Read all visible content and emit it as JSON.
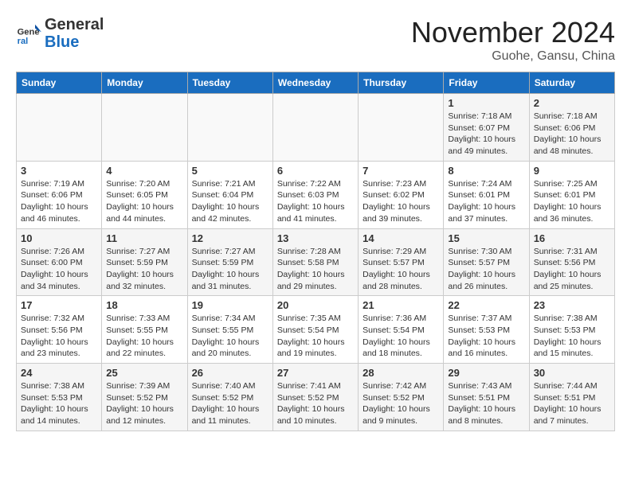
{
  "header": {
    "logo_line1": "General",
    "logo_line2": "Blue",
    "month": "November 2024",
    "location": "Guohe, Gansu, China"
  },
  "weekdays": [
    "Sunday",
    "Monday",
    "Tuesday",
    "Wednesday",
    "Thursday",
    "Friday",
    "Saturday"
  ],
  "weeks": [
    [
      {
        "day": "",
        "detail": ""
      },
      {
        "day": "",
        "detail": ""
      },
      {
        "day": "",
        "detail": ""
      },
      {
        "day": "",
        "detail": ""
      },
      {
        "day": "",
        "detail": ""
      },
      {
        "day": "1",
        "detail": "Sunrise: 7:18 AM\nSunset: 6:07 PM\nDaylight: 10 hours\nand 49 minutes."
      },
      {
        "day": "2",
        "detail": "Sunrise: 7:18 AM\nSunset: 6:06 PM\nDaylight: 10 hours\nand 48 minutes."
      }
    ],
    [
      {
        "day": "3",
        "detail": "Sunrise: 7:19 AM\nSunset: 6:06 PM\nDaylight: 10 hours\nand 46 minutes."
      },
      {
        "day": "4",
        "detail": "Sunrise: 7:20 AM\nSunset: 6:05 PM\nDaylight: 10 hours\nand 44 minutes."
      },
      {
        "day": "5",
        "detail": "Sunrise: 7:21 AM\nSunset: 6:04 PM\nDaylight: 10 hours\nand 42 minutes."
      },
      {
        "day": "6",
        "detail": "Sunrise: 7:22 AM\nSunset: 6:03 PM\nDaylight: 10 hours\nand 41 minutes."
      },
      {
        "day": "7",
        "detail": "Sunrise: 7:23 AM\nSunset: 6:02 PM\nDaylight: 10 hours\nand 39 minutes."
      },
      {
        "day": "8",
        "detail": "Sunrise: 7:24 AM\nSunset: 6:01 PM\nDaylight: 10 hours\nand 37 minutes."
      },
      {
        "day": "9",
        "detail": "Sunrise: 7:25 AM\nSunset: 6:01 PM\nDaylight: 10 hours\nand 36 minutes."
      }
    ],
    [
      {
        "day": "10",
        "detail": "Sunrise: 7:26 AM\nSunset: 6:00 PM\nDaylight: 10 hours\nand 34 minutes."
      },
      {
        "day": "11",
        "detail": "Sunrise: 7:27 AM\nSunset: 5:59 PM\nDaylight: 10 hours\nand 32 minutes."
      },
      {
        "day": "12",
        "detail": "Sunrise: 7:27 AM\nSunset: 5:59 PM\nDaylight: 10 hours\nand 31 minutes."
      },
      {
        "day": "13",
        "detail": "Sunrise: 7:28 AM\nSunset: 5:58 PM\nDaylight: 10 hours\nand 29 minutes."
      },
      {
        "day": "14",
        "detail": "Sunrise: 7:29 AM\nSunset: 5:57 PM\nDaylight: 10 hours\nand 28 minutes."
      },
      {
        "day": "15",
        "detail": "Sunrise: 7:30 AM\nSunset: 5:57 PM\nDaylight: 10 hours\nand 26 minutes."
      },
      {
        "day": "16",
        "detail": "Sunrise: 7:31 AM\nSunset: 5:56 PM\nDaylight: 10 hours\nand 25 minutes."
      }
    ],
    [
      {
        "day": "17",
        "detail": "Sunrise: 7:32 AM\nSunset: 5:56 PM\nDaylight: 10 hours\nand 23 minutes."
      },
      {
        "day": "18",
        "detail": "Sunrise: 7:33 AM\nSunset: 5:55 PM\nDaylight: 10 hours\nand 22 minutes."
      },
      {
        "day": "19",
        "detail": "Sunrise: 7:34 AM\nSunset: 5:55 PM\nDaylight: 10 hours\nand 20 minutes."
      },
      {
        "day": "20",
        "detail": "Sunrise: 7:35 AM\nSunset: 5:54 PM\nDaylight: 10 hours\nand 19 minutes."
      },
      {
        "day": "21",
        "detail": "Sunrise: 7:36 AM\nSunset: 5:54 PM\nDaylight: 10 hours\nand 18 minutes."
      },
      {
        "day": "22",
        "detail": "Sunrise: 7:37 AM\nSunset: 5:53 PM\nDaylight: 10 hours\nand 16 minutes."
      },
      {
        "day": "23",
        "detail": "Sunrise: 7:38 AM\nSunset: 5:53 PM\nDaylight: 10 hours\nand 15 minutes."
      }
    ],
    [
      {
        "day": "24",
        "detail": "Sunrise: 7:38 AM\nSunset: 5:53 PM\nDaylight: 10 hours\nand 14 minutes."
      },
      {
        "day": "25",
        "detail": "Sunrise: 7:39 AM\nSunset: 5:52 PM\nDaylight: 10 hours\nand 12 minutes."
      },
      {
        "day": "26",
        "detail": "Sunrise: 7:40 AM\nSunset: 5:52 PM\nDaylight: 10 hours\nand 11 minutes."
      },
      {
        "day": "27",
        "detail": "Sunrise: 7:41 AM\nSunset: 5:52 PM\nDaylight: 10 hours\nand 10 minutes."
      },
      {
        "day": "28",
        "detail": "Sunrise: 7:42 AM\nSunset: 5:52 PM\nDaylight: 10 hours\nand 9 minutes."
      },
      {
        "day": "29",
        "detail": "Sunrise: 7:43 AM\nSunset: 5:51 PM\nDaylight: 10 hours\nand 8 minutes."
      },
      {
        "day": "30",
        "detail": "Sunrise: 7:44 AM\nSunset: 5:51 PM\nDaylight: 10 hours\nand 7 minutes."
      }
    ]
  ]
}
